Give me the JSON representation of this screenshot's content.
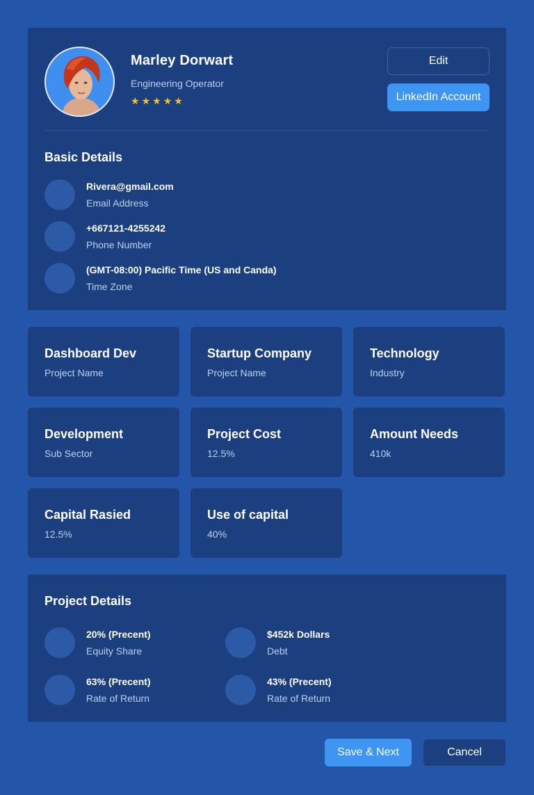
{
  "profile": {
    "name": "Marley Dorwart",
    "role": "Engineering Operator",
    "rating": 5,
    "star_glyph": "★",
    "edit_label": "Edit",
    "linkedin_label": "LinkedIn Account"
  },
  "basic_details": {
    "title": "Basic Details",
    "items": [
      {
        "value": "Rivera@gmail.com",
        "label": "Email Address",
        "icon": "email-icon"
      },
      {
        "value": "+667121-4255242",
        "label": "Phone Number",
        "icon": "phone-icon"
      },
      {
        "value": "(GMT-08:00) Pacific Time (US and Canda)",
        "label": "Time Zone",
        "icon": "clock-icon"
      }
    ]
  },
  "tiles": [
    {
      "title": "Dashboard Dev",
      "subtitle": "Project Name"
    },
    {
      "title": "Startup Company",
      "subtitle": "Project Name"
    },
    {
      "title": "Technology",
      "subtitle": "Industry"
    },
    {
      "title": "Development",
      "subtitle": "Sub Sector"
    },
    {
      "title": "Project Cost",
      "subtitle": "12.5%"
    },
    {
      "title": "Amount Needs",
      "subtitle": "410k"
    },
    {
      "title": "Capital Rasied",
      "subtitle": "12.5%"
    },
    {
      "title": "Use of capital",
      "subtitle": "40%"
    }
  ],
  "project_details": {
    "title": "Project Details",
    "items": [
      {
        "value": "20% (Precent)",
        "label": "Equity Share"
      },
      {
        "value": "$452k Dollars",
        "label": "Debt"
      },
      {
        "value": "63% (Precent)",
        "label": "Rate of Return"
      },
      {
        "value": "43% (Precent)",
        "label": "Rate of Return"
      }
    ]
  },
  "actions": {
    "save_label": "Save & Next",
    "cancel_label": "Cancel"
  },
  "colors": {
    "background": "#2355a8",
    "card": "#1c3f7f",
    "accent": "#3f95f2",
    "star": "#f8c22a",
    "muted_text": "#bcd0f2"
  }
}
